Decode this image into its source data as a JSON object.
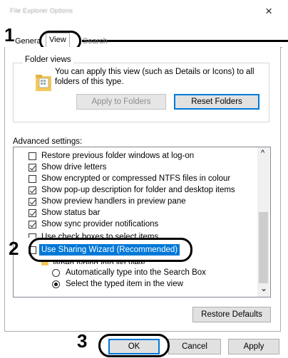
{
  "window": {
    "title": "File Explorer Options",
    "close_glyph": "×"
  },
  "tabs": [
    {
      "label": "General",
      "display": "Genera"
    },
    {
      "label": "View",
      "display": "View",
      "active": true
    },
    {
      "label": "Search",
      "display": "Search"
    }
  ],
  "callouts": {
    "c1": "1",
    "c2": "2",
    "c3": "3"
  },
  "folder_views": {
    "title": "Folder views",
    "description": "You can apply this view (such as Details or Icons) to all folders of this type.",
    "apply_label": "Apply to Folders",
    "reset_label": "Reset Folders"
  },
  "advanced": {
    "label": "Advanced settings:",
    "items": [
      {
        "label": "Restore previous folder windows at log-on",
        "type": "checkbox",
        "checked": false
      },
      {
        "label": "Show drive letters",
        "type": "checkbox",
        "checked": true
      },
      {
        "label": "Show encrypted or compressed NTFS files in colour",
        "type": "checkbox",
        "checked": false
      },
      {
        "label": "Show pop-up description for folder and desktop items",
        "type": "checkbox",
        "checked": true
      },
      {
        "label": "Show preview handlers in preview pane",
        "type": "checkbox",
        "checked": true
      },
      {
        "label": "Show status bar",
        "type": "checkbox",
        "checked": true
      },
      {
        "label": "Show sync provider notifications",
        "type": "checkbox",
        "checked": true
      },
      {
        "label": "Use check boxes to select items",
        "type": "checkbox",
        "checked": false
      },
      {
        "label": "Use Sharing Wizard (Recommended)",
        "type": "checkbox",
        "checked": false,
        "selected": true
      },
      {
        "label": "When typing into list view",
        "type": "folder"
      },
      {
        "label": "Automatically type into the Search Box",
        "type": "radio",
        "checked": false
      },
      {
        "label": "Select the typed item in the view",
        "type": "radio",
        "checked": true
      }
    ],
    "scroll_up": "^",
    "scroll_down": "⌄"
  },
  "restore_defaults_label": "Restore Defaults",
  "footer": {
    "ok_label": "OK",
    "cancel_label": "Cancel",
    "apply_label": "Apply"
  },
  "colors": {
    "accent": "#0078d7",
    "selection": "#0078d7",
    "callout": "#000000"
  }
}
